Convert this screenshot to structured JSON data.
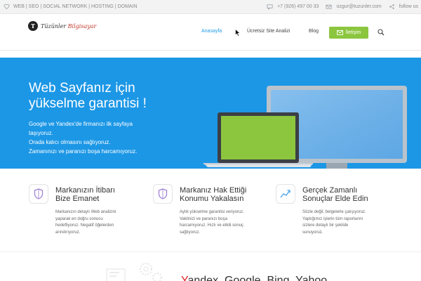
{
  "topbar": {
    "services": "WEB | SEO | SOCIAL NETWORK | HOSTING | DOMAIN",
    "phone": "+7 (926) 497 00 33",
    "email": "ozgur@tuzunler.com",
    "follow": "follow us"
  },
  "header": {
    "logo_letter": "T",
    "logo_name": "Tüzünler",
    "logo_suffix": "Bilgisayar",
    "nav": [
      "Anasayfa",
      "Ücretsiz Site Analizi",
      "Blog"
    ],
    "contact_label": "İletişim"
  },
  "hero": {
    "title_line1": "Web Sayfanız için",
    "title_line2": "yükselme garantisi !",
    "lines": [
      "Google ve Yandex'de firmanızı ilk sayfaya",
      "taşıyoruz.",
      "Orada kalıcı olmasını sağlıyoruz.",
      "Zamanınızı ve paranızı boşa harcamıyoruz."
    ]
  },
  "features": [
    {
      "title_line1": "Markanızın İtibarı",
      "title_line2": "Bize Emanet",
      "desc": [
        "Markanızın detaylı Web analizini",
        "yaparak en doğru sonucu",
        "hedefliyoruz. Negatif öğelerden",
        "arındırıyoruz."
      ],
      "icon": "shield-icon"
    },
    {
      "title_line1": "Markanız Hak Ettiği",
      "title_line2": "Konumu Yakalasın",
      "desc": [
        "Aylık yükselme garantisi veriyoruz.",
        "Vaktinizi ve paranızı boşa",
        "harcamıyoruz. Hızlı ve etkili sonuç",
        "sağlıyoruz."
      ],
      "icon": "shield-icon"
    },
    {
      "title_line1": "Gerçek Zamanlı",
      "title_line2": "Sonuçlar Elde Edin",
      "desc": [
        "Sözle değil, belgelerle çalışıyoruz.",
        "Yaptığımız işlerin tüm raporlarını",
        "sizlere detaylı bir şekilde",
        "sunuyoruz."
      ],
      "icon": "trend-chart-icon"
    }
  ],
  "bottom": {
    "first_letter": "Y",
    "rest": "andex, Google, Bing, Yahoo"
  },
  "colors": {
    "accent": "#1e9be9",
    "hero_bg": "#1c97e6",
    "contact_green": "#8cc63f",
    "brand_red": "#e02020"
  }
}
